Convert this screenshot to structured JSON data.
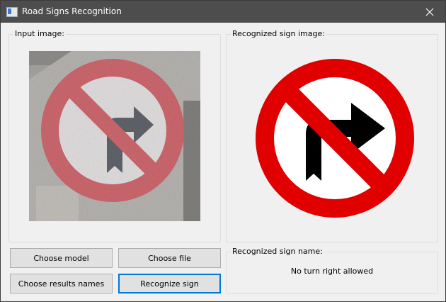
{
  "window": {
    "title": "Road Signs Recognition",
    "close_icon": "close-icon"
  },
  "input_panel": {
    "title": "Input image:"
  },
  "recognized_panel": {
    "title": "Recognized sign image:"
  },
  "name_panel": {
    "title": "Recognized sign name:",
    "value": "No turn right allowed"
  },
  "buttons": {
    "choose_model": "Choose model",
    "choose_file": "Choose file",
    "choose_results_names": "Choose results names",
    "recognize_sign": "Recognize sign"
  },
  "colors": {
    "titlebar": "#4d4d4d",
    "window_bg": "#f0f0f0",
    "sign_red": "#e10000",
    "default_button_border": "#0078d7"
  }
}
